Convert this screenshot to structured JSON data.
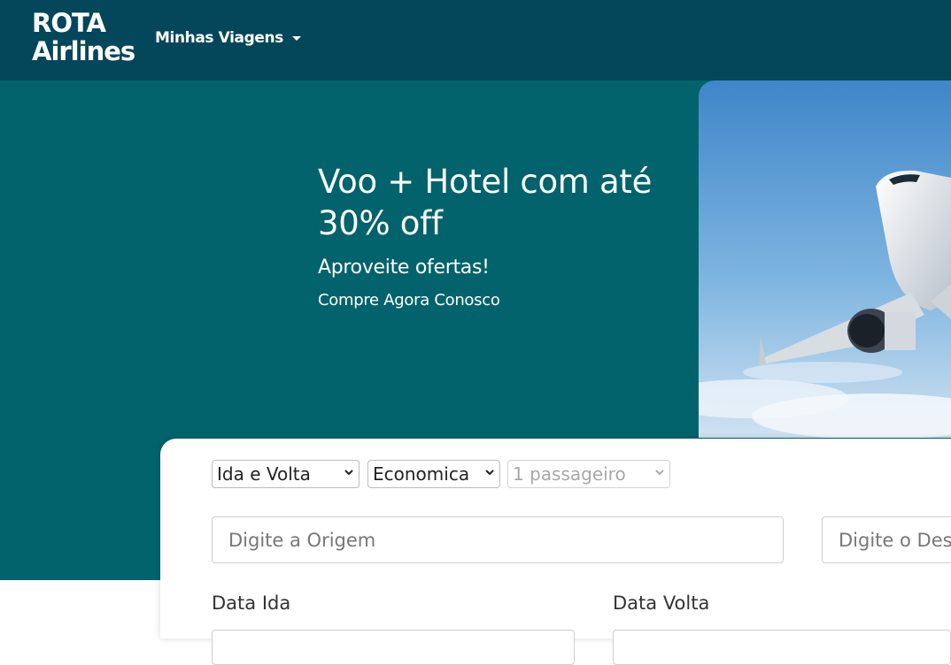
{
  "navbar": {
    "brand_line1": "ROTA",
    "brand_line2": "Airlines",
    "menu_label": "Minhas Viagens"
  },
  "hero": {
    "title": "Voo + Hotel com até 30% off",
    "subtitle": "Aproveite ofertas!",
    "cta": "Compre Agora Conosco"
  },
  "search": {
    "trip_type": "Ida e Volta",
    "cabin_class": "Economica",
    "passengers": "1 passageiro",
    "origin_placeholder": "Digite a Origem",
    "destination_placeholder": "Digite o Des",
    "date_departure_label": "Data Ida",
    "date_return_label": "Data Volta"
  },
  "colors": {
    "navbar": "#05475a",
    "hero": "#02636c"
  }
}
